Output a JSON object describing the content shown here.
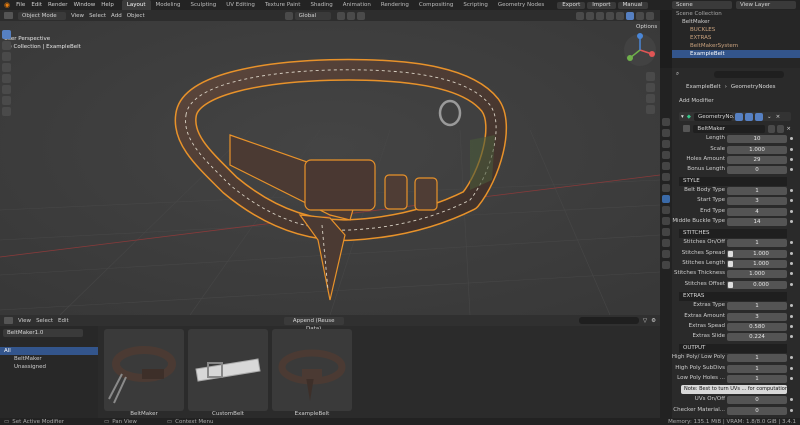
{
  "menubar": {
    "menus": [
      "File",
      "Edit",
      "Render",
      "Window",
      "Help"
    ],
    "workspaces": [
      "Layout",
      "Modeling",
      "Sculpting",
      "UV Editing",
      "Texture Paint",
      "Shading",
      "Animation",
      "Rendering",
      "Compositing",
      "Scripting",
      "Geometry Nodes"
    ],
    "active_workspace": "Layout",
    "actions": [
      "Export",
      "Import",
      "Manual"
    ],
    "scene": "Scene",
    "view_layer": "View Layer"
  },
  "viewport": {
    "mode": "Object Mode",
    "menus": [
      "View",
      "Select",
      "Add",
      "Object"
    ],
    "transform_orientation": "Global",
    "perspective_label": "User Perspective",
    "collection_label": "(1) Collection | ExampleBelt",
    "options_label": "Options"
  },
  "outliner": {
    "rows": [
      {
        "label": "Scene Collection",
        "selected": false
      },
      {
        "label": "BeltMaker",
        "selected": false
      },
      {
        "label": "BUCKLES",
        "selected": false
      },
      {
        "label": "EXTRAS",
        "selected": false
      },
      {
        "label": "BeltMakerSystem",
        "selected": false
      },
      {
        "label": "ExampleBelt",
        "selected": true
      }
    ]
  },
  "properties": {
    "object_name": "ExampleBelt",
    "modifier_path": "GeometryNodes",
    "add_modifier": "Add Modifier",
    "modifier_name": "GeometryNo...",
    "node_group": "BeltMaker",
    "general": [
      {
        "label": "Length",
        "value": "10"
      },
      {
        "label": "Scale",
        "value": "1.000"
      },
      {
        "label": "Holes Amount",
        "value": "29"
      },
      {
        "label": "Bonus Length",
        "value": "0"
      }
    ],
    "sections": {
      "style": "STYLE",
      "stitches": "STITCHES",
      "extras": "EXTRAS",
      "output": "OUTPUT"
    },
    "style": [
      {
        "label": "Belt Body Type",
        "value": "1"
      },
      {
        "label": "Start Type",
        "value": "3"
      },
      {
        "label": "End Type",
        "value": "4"
      },
      {
        "label": "Middle Buckle Type",
        "value": "14"
      }
    ],
    "stitches": [
      {
        "label": "Stitches On/Off",
        "value": "1"
      },
      {
        "label": "Stitches Spread",
        "value": "1.000"
      },
      {
        "label": "Stitches Length",
        "value": "1.000"
      },
      {
        "label": "Stitches Thickness",
        "value": "1.000"
      },
      {
        "label": "Stitches Offset",
        "value": "0.000"
      }
    ],
    "extras": [
      {
        "label": "Extras Type",
        "value": "1"
      },
      {
        "label": "Extras Amount",
        "value": "3"
      },
      {
        "label": "Extras Spead",
        "value": "0.580"
      },
      {
        "label": "Extras Slide",
        "value": "0.224"
      }
    ],
    "output": [
      {
        "label": "High Poly/ Low Poly",
        "value": "1"
      },
      {
        "label": "High Poly SubDivs",
        "value": "1"
      },
      {
        "label": "Low Poly Holes ...",
        "value": "1"
      }
    ],
    "note": "Note: Best to turn UVs ... for computation speed",
    "after_note": [
      {
        "label": "UVs On/Off",
        "value": "0"
      },
      {
        "label": "Checker Material...",
        "value": "0"
      }
    ]
  },
  "asset_browser": {
    "menus": [
      "View",
      "Select",
      "Edit"
    ],
    "library": "BeltMaker1.0",
    "import_method": "Append (Reuse Data)",
    "catalogs": [
      "All",
      "BeltMaker",
      "Unassigned"
    ],
    "assets": [
      "BeltMaker",
      "CustomBelt",
      "ExampleBelt"
    ]
  },
  "statusbar": {
    "hint1": "Set Active Modifier",
    "hint2": "Pan View",
    "hint3": "Context Menu",
    "stats": "Memory: 135.1 MiB | VRAM: 1.8/8.0 GiB | 3.4.1"
  },
  "colors": {
    "accent": "#5680c2",
    "selection_outline": "#e8922a",
    "leather": "#4b3a33",
    "stitch": "#d9d2c5"
  }
}
